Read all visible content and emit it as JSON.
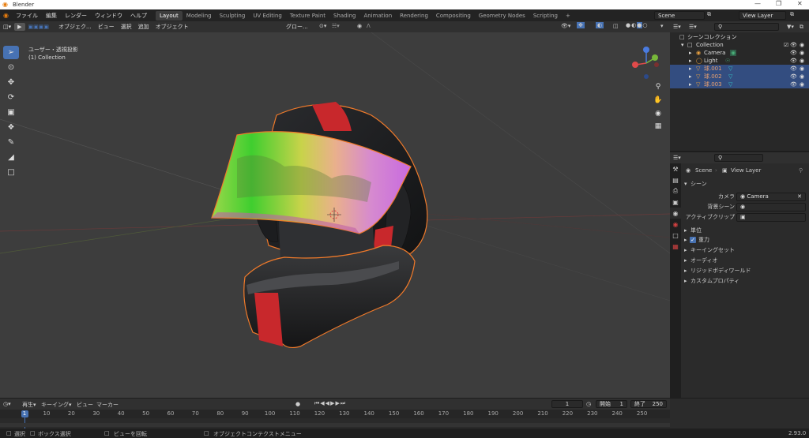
{
  "window": {
    "title": "Blender",
    "minimize": "—",
    "maximize": "❐",
    "close": "✕"
  },
  "menubar": {
    "menus": [
      "ファイル",
      "編集",
      "レンダー",
      "ウィンドウ",
      "ヘルプ"
    ],
    "workspaces": [
      "Layout",
      "Modeling",
      "Sculpting",
      "UV Editing",
      "Texture Paint",
      "Shading",
      "Animation",
      "Rendering",
      "Compositing",
      "Geometry Nodes",
      "Scripting"
    ],
    "active_workspace": "Layout",
    "add_workspace": "+",
    "scene": "Scene",
    "view_layer": "View Layer"
  },
  "viewport_header": {
    "mode": "オブジェク...",
    "menus": [
      "ビュー",
      "選択",
      "追加",
      "オブジェクト"
    ],
    "transform": "グロー...",
    "options": "オプション"
  },
  "viewport": {
    "view_name": "ユーザー・透視投影",
    "collection": "(1) Collection"
  },
  "outliner": {
    "search_placeholder": "",
    "root": "シーンコレクション",
    "collection": "Collection",
    "objects": [
      {
        "name": "Camera",
        "color": "#e0e0e0",
        "selected": false
      },
      {
        "name": "Light",
        "color": "#e0e0e0",
        "selected": false
      },
      {
        "name": "球.001",
        "color": "#e8a070",
        "selected": true
      },
      {
        "name": "球.002",
        "color": "#e8a070",
        "selected": true
      },
      {
        "name": "球.003",
        "color": "#e8a070",
        "selected": true
      }
    ]
  },
  "properties": {
    "scene": "Scene",
    "view_layer": "View Layer",
    "panel_title": "シーン",
    "camera_label": "カメラ",
    "camera_value": "Camera",
    "background_label": "背景シーン",
    "active_clip_label": "アクティブクリップ",
    "sections": [
      "単位",
      "重力",
      "キーイングセット",
      "オーディオ",
      "リジッドボディワールド",
      "カスタムプロパティ"
    ]
  },
  "timeline": {
    "menus": [
      "再生",
      "キーイング",
      "ビュー",
      "マーカー"
    ],
    "current_frame": "1",
    "start_label": "開始",
    "start": "1",
    "end_label": "終了",
    "end": "250",
    "ticks": [
      "1",
      "10",
      "20",
      "30",
      "40",
      "50",
      "60",
      "70",
      "80",
      "90",
      "100",
      "110",
      "120",
      "130",
      "140",
      "150",
      "160",
      "170",
      "180",
      "190",
      "200",
      "210",
      "220",
      "230",
      "240",
      "250"
    ]
  },
  "statusbar": {
    "select": "選択",
    "box_select": "ボックス選択",
    "rotate_view": "ビューを回転",
    "context_menu": "オブジェクトコンテクストメニュー",
    "version": "2.93.0"
  },
  "colors": {
    "accent": "#4772b3",
    "selection_outline": "#f07a2a",
    "helmet_red": "#c8282c"
  }
}
